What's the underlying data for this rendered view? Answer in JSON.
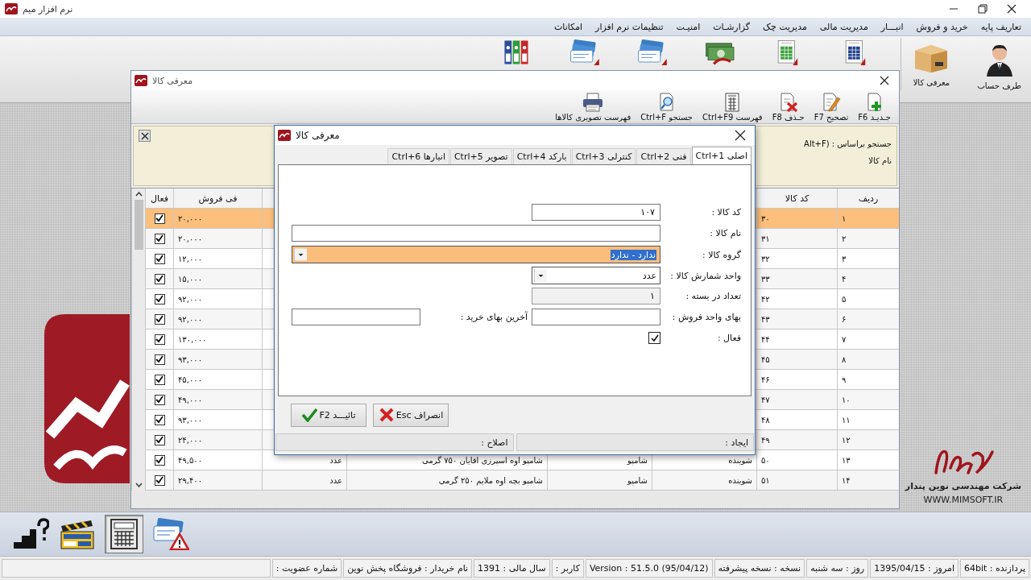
{
  "window": {
    "title": "نرم افزار میم"
  },
  "menu": [
    "تعاریف پایه",
    "خرید و فروش",
    "انبـــار",
    "مدیریت مالی",
    "مدیریت چک",
    "گزارشـات",
    "امنیـت",
    "تنظیمات نرم افزار",
    "امکانات"
  ],
  "toolbar": [
    {
      "kind": "person",
      "label": "طرف حساب"
    },
    {
      "kind": "box",
      "label": "معرفی کالا"
    },
    {
      "kind": "sheet_blue"
    },
    {
      "kind": "sheet_green"
    },
    {
      "kind": "money"
    },
    {
      "kind": "cards"
    },
    {
      "kind": "cards"
    },
    {
      "kind": "binders"
    }
  ],
  "goods_window": {
    "title": "معرفی کالا",
    "toolbar": [
      {
        "kind": "add",
        "label": "جـدیـد F6"
      },
      {
        "kind": "edit",
        "label": "تصحیح F7"
      },
      {
        "kind": "delete",
        "label": "حـذف F8"
      },
      {
        "kind": "list",
        "label": "فهرست Ctrl+F9"
      },
      {
        "kind": "search",
        "label": "جستجو Ctrl+F"
      },
      {
        "kind": "print",
        "label": "فهرست تصویری کالاها"
      }
    ],
    "search_panel": {
      "search_by": "جستجو براساس : (Alt+F",
      "field_label": "نام کالا"
    },
    "table": {
      "columns": [
        {
          "label": "ردیف"
        },
        {
          "label": "کد کالا"
        },
        {
          "label": "فی فروش"
        },
        {
          "label": "فعال"
        }
      ],
      "rows": [
        {
          "row": "۱",
          "code": "۳۰",
          "price": "۲۰,۰۰۰",
          "active": true,
          "selected": true
        },
        {
          "row": "۲",
          "code": "۳۱",
          "price": "۲۰,۰۰۰",
          "active": true,
          "selected": false
        },
        {
          "row": "۳",
          "code": "۳۲",
          "price": "۱۲,۰۰۰",
          "active": true,
          "selected": false
        },
        {
          "row": "۴",
          "code": "۳۳",
          "price": "۱۵,۰۰۰",
          "active": true,
          "selected": false
        },
        {
          "row": "۵",
          "code": "۴۲",
          "price": "۹۲,۰۰۰",
          "active": true,
          "selected": false
        },
        {
          "row": "۶",
          "code": "۴۳",
          "price": "۹۲,۰۰۰",
          "active": true,
          "selected": false
        },
        {
          "row": "۷",
          "code": "۴۴",
          "price": "۱۳۰,۰۰۰",
          "active": true,
          "selected": false
        },
        {
          "row": "۸",
          "code": "۴۵",
          "price": "۹۳,۰۰۰",
          "active": true,
          "selected": false
        },
        {
          "row": "۹",
          "code": "۴۶",
          "price": "۴۵,۰۰۰",
          "active": true,
          "selected": false
        },
        {
          "row": "۱۰",
          "code": "۴۷",
          "price": "۴۹,۰۰۰",
          "active": true,
          "selected": false
        },
        {
          "row": "۱۱",
          "code": "۴۸",
          "price": "۹۳,۰۰۰",
          "active": true,
          "selected": false
        },
        {
          "row": "۱۲",
          "code": "۴۹",
          "price": "۲۴,۰۰۰",
          "active": true,
          "selected": false
        },
        {
          "row": "۱۳",
          "code": "۵۰",
          "column_3": "شوینده",
          "column_4": "شامپو",
          "column_5": "شامپو اوه اسپرزی اقایان ۷۵۰ گرمی",
          "column_6": "عدد",
          "price": "۴۹,۵۰۰",
          "active": true,
          "selected": false
        },
        {
          "row": "۱۴",
          "code": "۵۱",
          "column_3": "شوینده",
          "column_4": "شامپو",
          "column_5": "شامپو بچه اوه ملایم ۲۵۰ گرمی",
          "column_6": "عدد",
          "price": "۲۹,۴۰۰",
          "active": true,
          "selected": false
        }
      ]
    }
  },
  "dialog": {
    "title": "معرفی کالا",
    "tabs": [
      {
        "label": "اصلی Ctrl+1",
        "selected": true
      },
      {
        "label": "فنی Ctrl+2",
        "selected": false
      },
      {
        "label": "کنترلی Ctrl+3",
        "selected": false
      },
      {
        "label": "بارکد Ctrl+4",
        "selected": false
      },
      {
        "label": "تصویر Ctrl+5",
        "selected": false
      },
      {
        "label": "انبارها Ctrl+6",
        "selected": false
      }
    ],
    "form": [
      [
        {
          "label": "کد کالا :",
          "kind": "text",
          "value": "۱۰۷",
          "focused": false,
          "readonly": false
        }
      ],
      [
        {
          "label": "نام کالا :",
          "kind": "wide_text",
          "focused": false,
          "readonly": false
        }
      ],
      [
        {
          "label": "گروه کالا :",
          "kind": "wide_combo",
          "value": "ندارد - ندارد",
          "focused": true,
          "readonly": false
        }
      ],
      [
        {
          "label": "واحد شمارش کالا :",
          "kind": "combo",
          "value": "عدد",
          "focused": false,
          "readonly": false
        }
      ],
      [
        {
          "label": "تعداد در بسته :",
          "kind": "text",
          "value": "۱",
          "focused": false,
          "readonly": true
        }
      ],
      [
        {
          "label": "بهای واحد فروش :",
          "kind": "text",
          "focused": false,
          "readonly": false
        },
        {
          "label": "آخرین بهای خرید :",
          "kind": "text",
          "focused": false,
          "readonly": false
        }
      ],
      [
        {
          "label": "فعال :",
          "kind": "checkbox",
          "checked": true
        }
      ]
    ],
    "buttons": [
      {
        "kind": "cancel",
        "label": "انصراف Esc"
      },
      {
        "kind": "confirm",
        "label": "تائیـــد F2"
      }
    ],
    "status": [
      "ایجاد :",
      "اصلاح :"
    ]
  },
  "taskbar": [
    {
      "kind": "help",
      "selected": false
    },
    {
      "kind": "clapper",
      "selected": false
    },
    {
      "kind": "calculator",
      "selected": true
    },
    {
      "kind": "cards_warning",
      "selected": false
    }
  ],
  "branding": {
    "company": "شرکت مهندسی نوین پندار",
    "website": "WWW.MIMSOFT.IR"
  },
  "status_bar": [
    "پردازنده : 64bit",
    "امروز : 1395/04/15",
    "روز : سه شنبه",
    "نسخه : نسخه پیشرفته",
    "Version : 51.5.0 (95/04/12)",
    "کاربر :",
    "سال مالی : 1391",
    "نام خریدار : فروشگاه پخش نوین",
    "شماره عضویت :"
  ]
}
